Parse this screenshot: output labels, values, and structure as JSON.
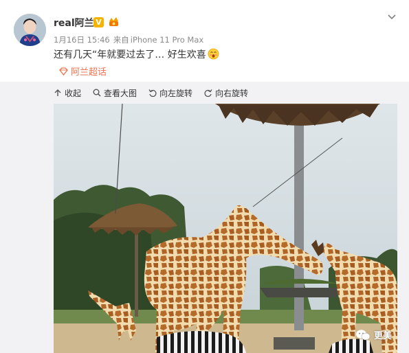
{
  "post": {
    "username": "real阿兰",
    "verified_badge": "V",
    "date": "1月16日 15:46",
    "source_prefix": "来自",
    "source_device": "iPhone 11 Pro Max",
    "text": "还有几天“年就要过去了… 好生欢喜",
    "topic": "阿兰超话"
  },
  "toolbar": {
    "collapse": "收起",
    "view_full": "查看大图",
    "rotate_left": "向左旋转",
    "rotate_right": "向右旋转"
  },
  "watermark": {
    "label": "更美"
  },
  "colors": {
    "topic": "#eb7350",
    "badge": "#f6b400",
    "media_background": "#f2f2f5"
  },
  "icons": [
    "chevron-down-icon",
    "v-badge-icon",
    "level-badge-icon",
    "emoji-icon",
    "topic-icon",
    "collapse-icon",
    "zoom-icon",
    "rotate-left-icon",
    "rotate-right-icon",
    "wechat-icon"
  ]
}
